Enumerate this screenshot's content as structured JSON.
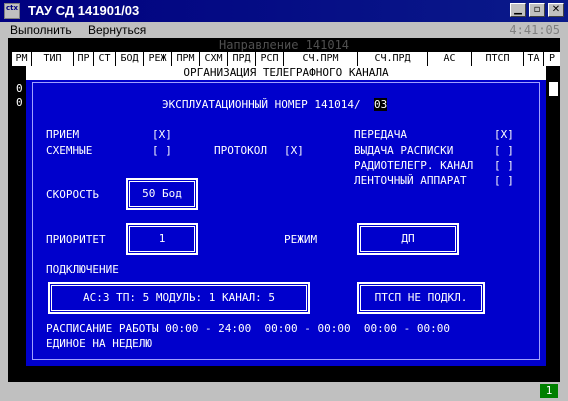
{
  "window": {
    "title": "ТАУ СД 141901/03",
    "icon_label": "ctx"
  },
  "menu": {
    "execute": "Выполнить",
    "back": "Вернуться",
    "clock": "4:41:05"
  },
  "terminal": {
    "direction": "Направление 141014",
    "headers": [
      "РМ",
      "ТИП",
      "ПР",
      "СТ",
      "БОД",
      "РЕЖ",
      "ПРМ",
      "СХМ",
      "ПРД",
      "РСП",
      "СЧ.ПРМ",
      "СЧ.ПРД",
      "АС",
      "ПТСП",
      "ТА",
      "Р"
    ],
    "left_marks": [
      "0",
      "0"
    ]
  },
  "dialog": {
    "title": "ОРГАНИЗАЦИЯ ТЕЛЕГРАФНОГО КАНАЛА",
    "op_number_label": "ЭКСПЛУАТАЦИОННЫЙ НОМЕР 141014/",
    "op_number_cursor": "03",
    "receive_label": "ПРИЕМ",
    "receive_value": "[X]",
    "schemes_label": "СХЕМНЫЕ",
    "schemes_value": "[ ]",
    "protocol_label": "ПРОТОКОЛ",
    "protocol_value": "[X]",
    "transmit_label": "ПЕРЕДАЧА",
    "transmit_value": "[X]",
    "receipt_label": "ВЫДАЧА РАСПИСКИ",
    "receipt_value": "[ ]",
    "radio_label": "РАДИОТЕЛЕГР. КАНАЛ",
    "radio_value": "[ ]",
    "tape_label": "ЛЕНТОЧНЫЙ АППАРАТ",
    "tape_value": "[ ]",
    "speed_label": "СКОРОСТЬ",
    "speed_value": "50 Бод",
    "priority_label": "ПРИОРИТЕТ",
    "priority_value": "1",
    "mode_label": "РЕЖИМ",
    "mode_value": "ДП",
    "connection_label": "ПОДКЛЮЧЕНИЕ",
    "connection_value": "АС:3  ТП:  5  МОДУЛЬ: 1  КАНАЛ:  5",
    "ptsp_value": "ПТСП НЕ ПОДКЛ.",
    "schedule_line1": "РАСПИСАНИЕ РАБОТЫ 00:00 - 24:00  00:00 - 00:00  00:00 - 00:00",
    "schedule_line2": "ЕДИНОЕ НА НЕДЕЛЮ"
  },
  "status": {
    "badge": "1"
  }
}
